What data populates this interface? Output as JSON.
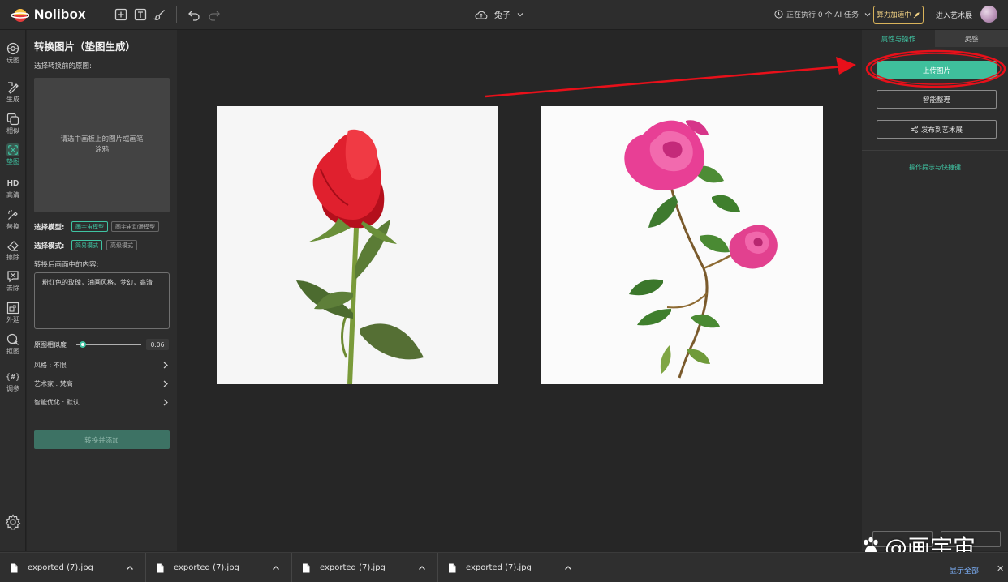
{
  "app": {
    "name": "Nolibox",
    "project_name": "兔子"
  },
  "topbar": {
    "task_status": "正在执行 0 个 AI 任务",
    "boost_label": "算力加速中",
    "enter_art_label": "进入艺术展"
  },
  "rail": {
    "items": [
      {
        "label": "玩图",
        "icon": "play-image-icon"
      },
      {
        "label": "生成",
        "icon": "generate-icon"
      },
      {
        "label": "相似",
        "icon": "similar-icon"
      },
      {
        "label": "垫图",
        "icon": "pad-image-icon"
      },
      {
        "label": "高清",
        "icon": "hd-icon",
        "glyph": "HD"
      },
      {
        "label": "替换",
        "icon": "replace-icon"
      },
      {
        "label": "擦除",
        "icon": "erase-icon"
      },
      {
        "label": "去除",
        "icon": "remove-icon"
      },
      {
        "label": "外延",
        "icon": "outpaint-icon"
      },
      {
        "label": "抠图",
        "icon": "cutout-icon"
      },
      {
        "label": "调参",
        "icon": "params-icon",
        "glyph": "{#}"
      }
    ],
    "active_index": 3
  },
  "left_panel": {
    "title": "转换图片（垫图生成）",
    "source_label": "选择转换前的原图:",
    "dropzone_text": "请选中画板上的图片或画笔涂鸦",
    "model_label": "选择模型:",
    "models": [
      "画宇宙模型",
      "画宇宙动漫模型"
    ],
    "selected_model": 0,
    "mode_label": "选择模式:",
    "modes": [
      "简易模式",
      "高级模式"
    ],
    "selected_mode": 0,
    "content_label": "转换后画面中的内容:",
    "prompt": "粉红色的玫瑰，油画风格，梦幻，高清",
    "similarity_label": "原图相似度",
    "similarity_value": "0.06",
    "similarity_fraction": 0.06,
    "options": [
      {
        "label": "风格 : 不限"
      },
      {
        "label": "艺术家 : 梵高"
      },
      {
        "label": "智能优化 : 默认"
      }
    ],
    "convert_button": "转换并添加"
  },
  "right_panel": {
    "tabs": [
      "属性与操作",
      "灵感"
    ],
    "active_tab": 0,
    "upload_button": "上传图片",
    "organize_button": "智能整理",
    "publish_button": "发布到艺术展",
    "hints_link": "操作提示与快捷键"
  },
  "colors": {
    "accent": "#3fc3a2",
    "annotation": "#e8101a",
    "boost": "#d9b35a"
  },
  "downloads": {
    "items": [
      {
        "filename": "exported (7).jpg"
      },
      {
        "filename": "exported (7).jpg"
      },
      {
        "filename": "exported (7).jpg"
      },
      {
        "filename": "exported (7).jpg"
      }
    ],
    "show_all": "显示全部"
  },
  "watermark": {
    "text": "@画宇宙"
  }
}
